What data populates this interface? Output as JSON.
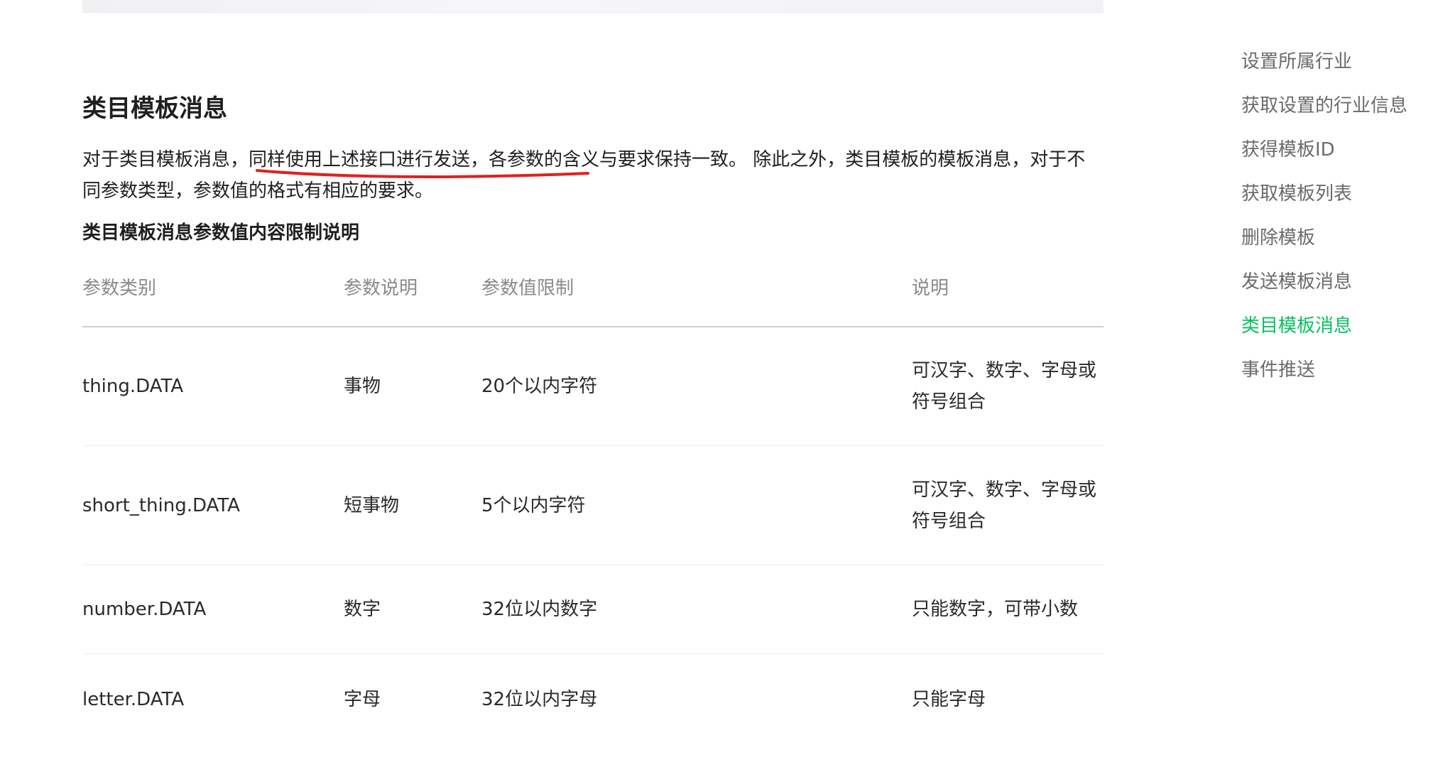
{
  "section": {
    "title": "类目模板消息",
    "desc_before": "对于类目模板消息，",
    "desc_highlight": "同样使用上述接口进行发送",
    "desc_after": "，各参数的含义与要求保持一致。 除此之外，类目模板的模板消息，对于不同参数类型，参数值的格式有相应的要求。",
    "subheading": "类目模板消息参数值内容限制说明"
  },
  "table": {
    "headers": [
      "参数类别",
      "参数说明",
      "参数值限制",
      "说明"
    ],
    "rows": [
      {
        "category": "thing.DATA",
        "meaning": "事物",
        "limit": "20个以内字符",
        "note": "可汉字、数字、字母或符号组合"
      },
      {
        "category": "short_thing.DATA",
        "meaning": "短事物",
        "limit": "5个以内字符",
        "note": "可汉字、数字、字母或符号组合"
      },
      {
        "category": "number.DATA",
        "meaning": "数字",
        "limit": "32位以内数字",
        "note": "只能数字，可带小数"
      },
      {
        "category": "letter.DATA",
        "meaning": "字母",
        "limit": "32位以内字母",
        "note": "只能字母"
      }
    ]
  },
  "toc": {
    "items": [
      {
        "label": "设置所属行业",
        "active": false
      },
      {
        "label": "获取设置的行业信息",
        "active": false
      },
      {
        "label": "获得模板ID",
        "active": false
      },
      {
        "label": "获取模板列表",
        "active": false
      },
      {
        "label": "删除模板",
        "active": false
      },
      {
        "label": "发送模板消息",
        "active": false
      },
      {
        "label": "类目模板消息",
        "active": true
      },
      {
        "label": "事件推送",
        "active": false
      }
    ]
  },
  "colors": {
    "accent": "#07c160",
    "annotation": "#e02020"
  }
}
